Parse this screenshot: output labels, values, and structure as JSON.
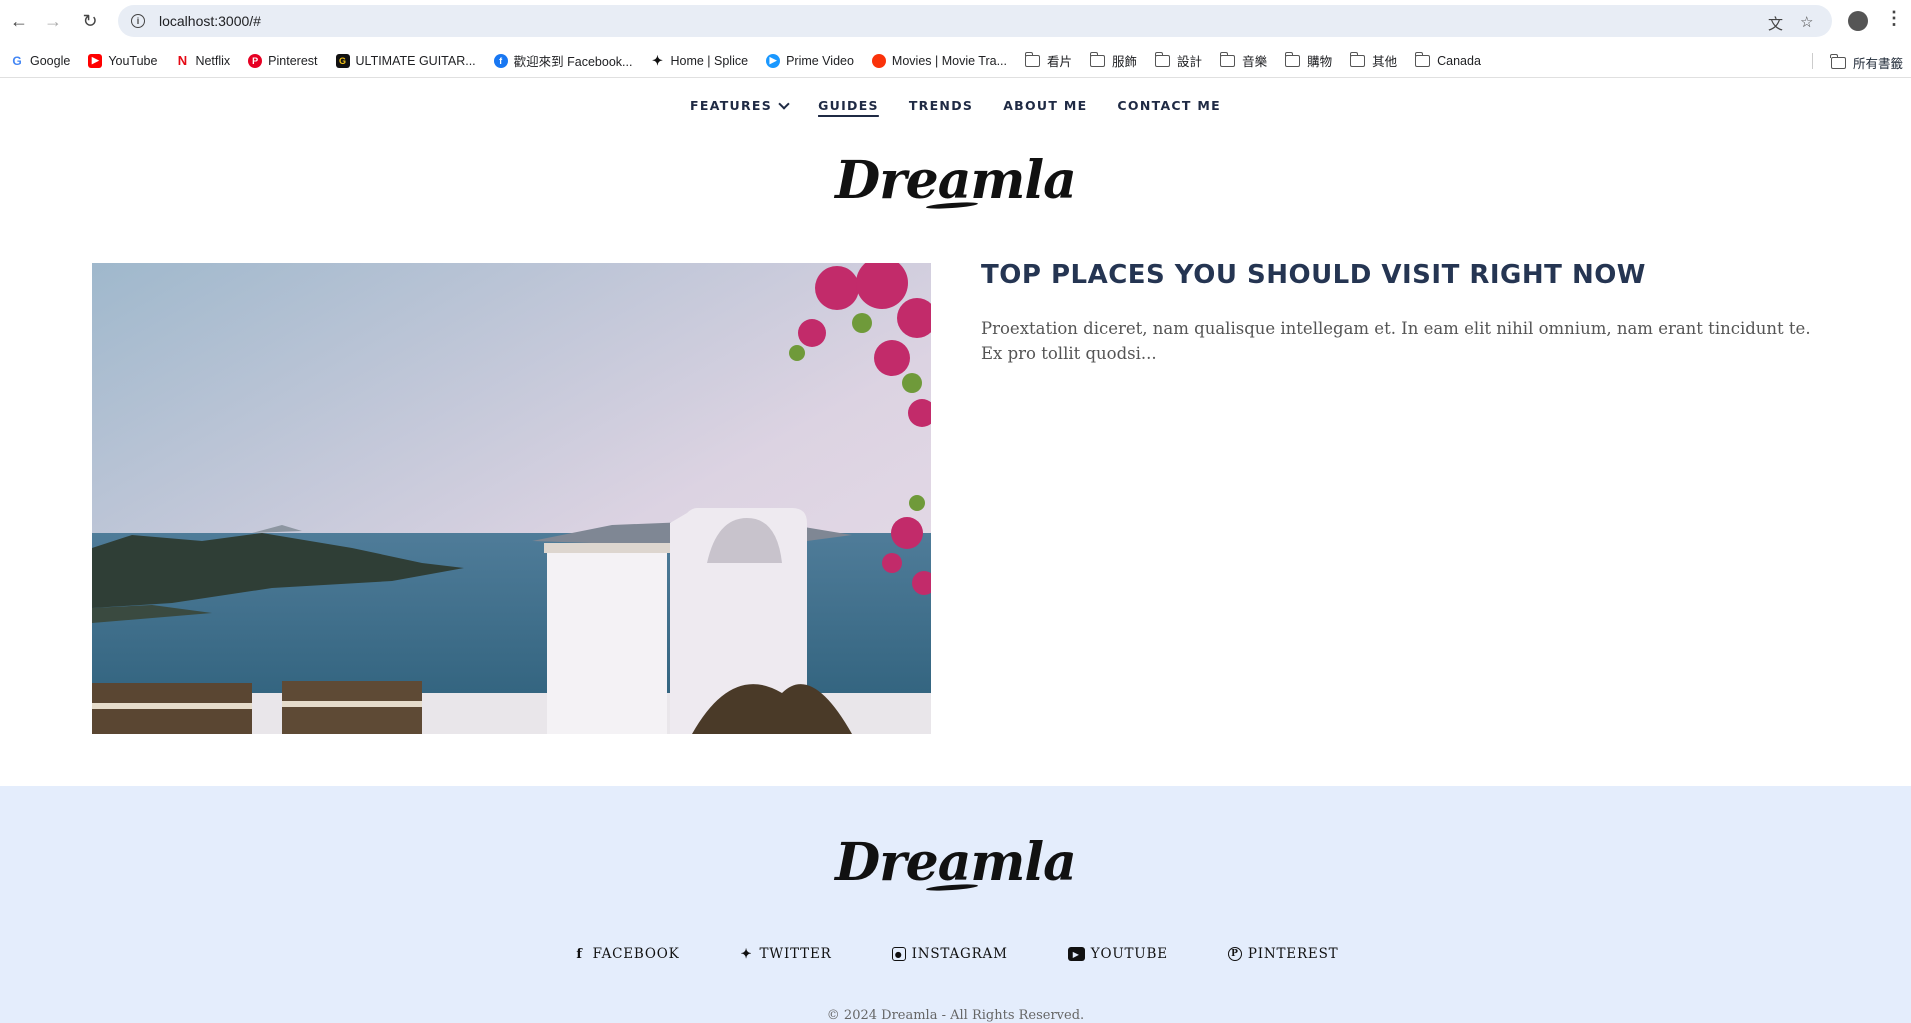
{
  "browser": {
    "url": "localhost:3000/#",
    "bookmarks": [
      {
        "label": "Google",
        "icon": "google-icon",
        "color": "#4285f4"
      },
      {
        "label": "YouTube",
        "icon": "youtube-icon",
        "color": "#ff0000"
      },
      {
        "label": "Netflix",
        "icon": "netflix-icon",
        "color": "#e50914"
      },
      {
        "label": "Pinterest",
        "icon": "pinterest-icon",
        "color": "#e60023"
      },
      {
        "label": "ULTIMATE GUITAR...",
        "icon": "ultimate-guitar-icon",
        "color": "#111111"
      },
      {
        "label": "歡迎來到 Facebook...",
        "icon": "facebook-icon",
        "color": "#1877f2"
      },
      {
        "label": "Home | Splice",
        "icon": "splice-icon",
        "color": "#111111"
      },
      {
        "label": "Prime Video",
        "icon": "prime-video-icon",
        "color": "#1a98ff"
      },
      {
        "label": "Movies | Movie Tra...",
        "icon": "tomato-icon",
        "color": "#fa320a"
      }
    ],
    "folders": [
      "看片",
      "服飾",
      "設計",
      "音樂",
      "購物",
      "其他",
      "Canada"
    ],
    "all_bookmarks": "所有書籤"
  },
  "nav": {
    "features": "FEATURES",
    "guides": "GUIDES",
    "trends": "TRENDS",
    "about": "ABOUT ME",
    "contact": "CONTACT ME"
  },
  "brand": "Dreamla",
  "post": {
    "title": "TOP PLACES YOU SHOULD VISIT RIGHT NOW",
    "excerpt": "Proextation diceret, nam qualisque intellegam et. In eam elit nihil omnium, nam erant tincidunt te. Ex pro tollit quodsi..."
  },
  "footer": {
    "social": [
      {
        "label": "FACEBOOK",
        "icon": "facebook-icon"
      },
      {
        "label": "TWITTER",
        "icon": "twitter-icon"
      },
      {
        "label": "INSTAGRAM",
        "icon": "instagram-icon"
      },
      {
        "label": "YOUTUBE",
        "icon": "youtube-icon"
      },
      {
        "label": "PINTEREST",
        "icon": "pinterest-icon"
      }
    ],
    "copyright": "© 2024 Dreamla - All Rights Reserved."
  },
  "colors": {
    "nav_text": "#1f2a44",
    "title": "#253552",
    "footer_bg": "#e4edfc"
  }
}
